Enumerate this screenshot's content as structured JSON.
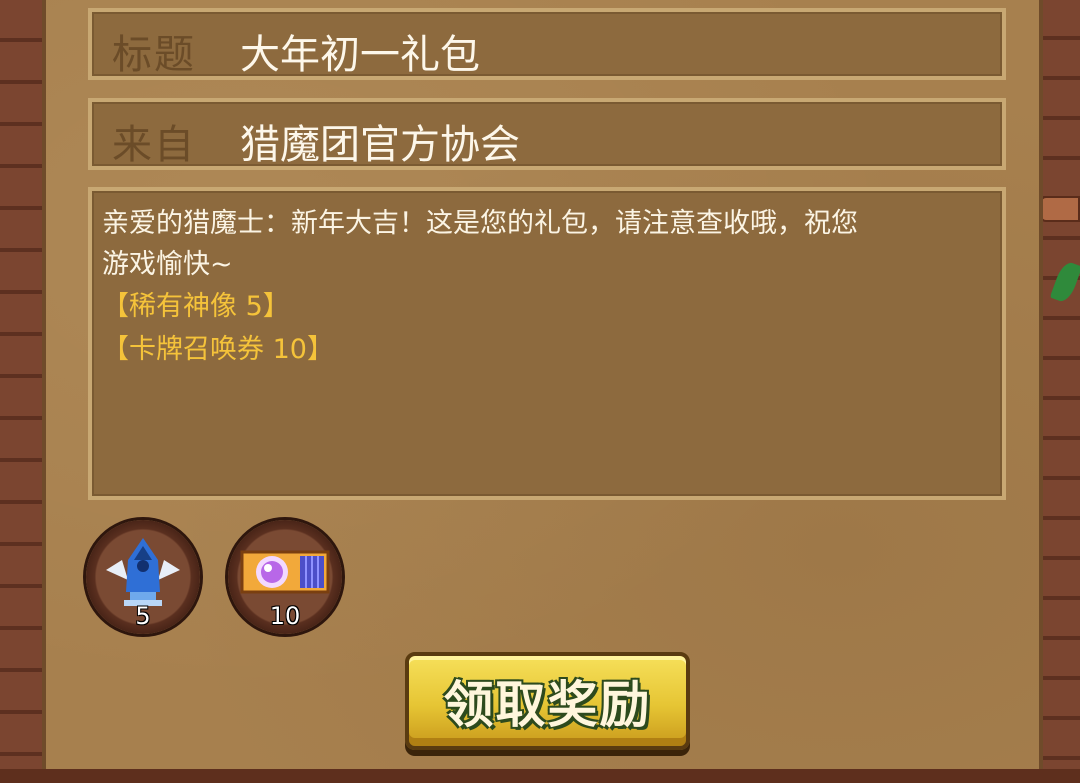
{
  "mail": {
    "title_label": "标题",
    "title_value": "大年初一礼包",
    "from_label": "来自",
    "from_value": "猎魔团官方协会",
    "body": "亲爱的猎魔士：新年大吉！这是您的礼包，请注意查收哦，祝您\n游戏愉快~",
    "reward_lines": [
      "【稀有神像 5】",
      "【卡牌召唤券 10】"
    ]
  },
  "rewards": [
    {
      "icon": "rare-statue-icon",
      "count": "5"
    },
    {
      "icon": "card-summon-ticket-icon",
      "count": "10"
    }
  ],
  "claim_button": {
    "label": "领取奖励"
  },
  "colors": {
    "reward_text": "#f5c33a",
    "button": "#f6e05a",
    "parchment": "#a7804e"
  }
}
